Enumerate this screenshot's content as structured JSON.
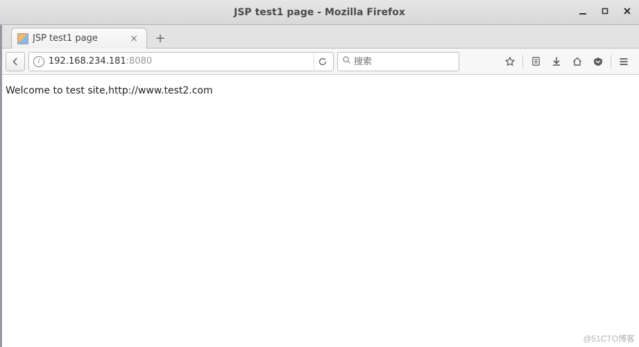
{
  "titlebar": {
    "title": "JSP test1 page - Mozilla Firefox"
  },
  "tab": {
    "title": "JSP test1 page"
  },
  "urlbar": {
    "host": "192.168.234.181",
    "port": ":8080"
  },
  "searchbar": {
    "placeholder": "搜索"
  },
  "content": {
    "body_text": "Welcome to test site,http://www.test2.com"
  },
  "watermark": "@51CTO博客"
}
